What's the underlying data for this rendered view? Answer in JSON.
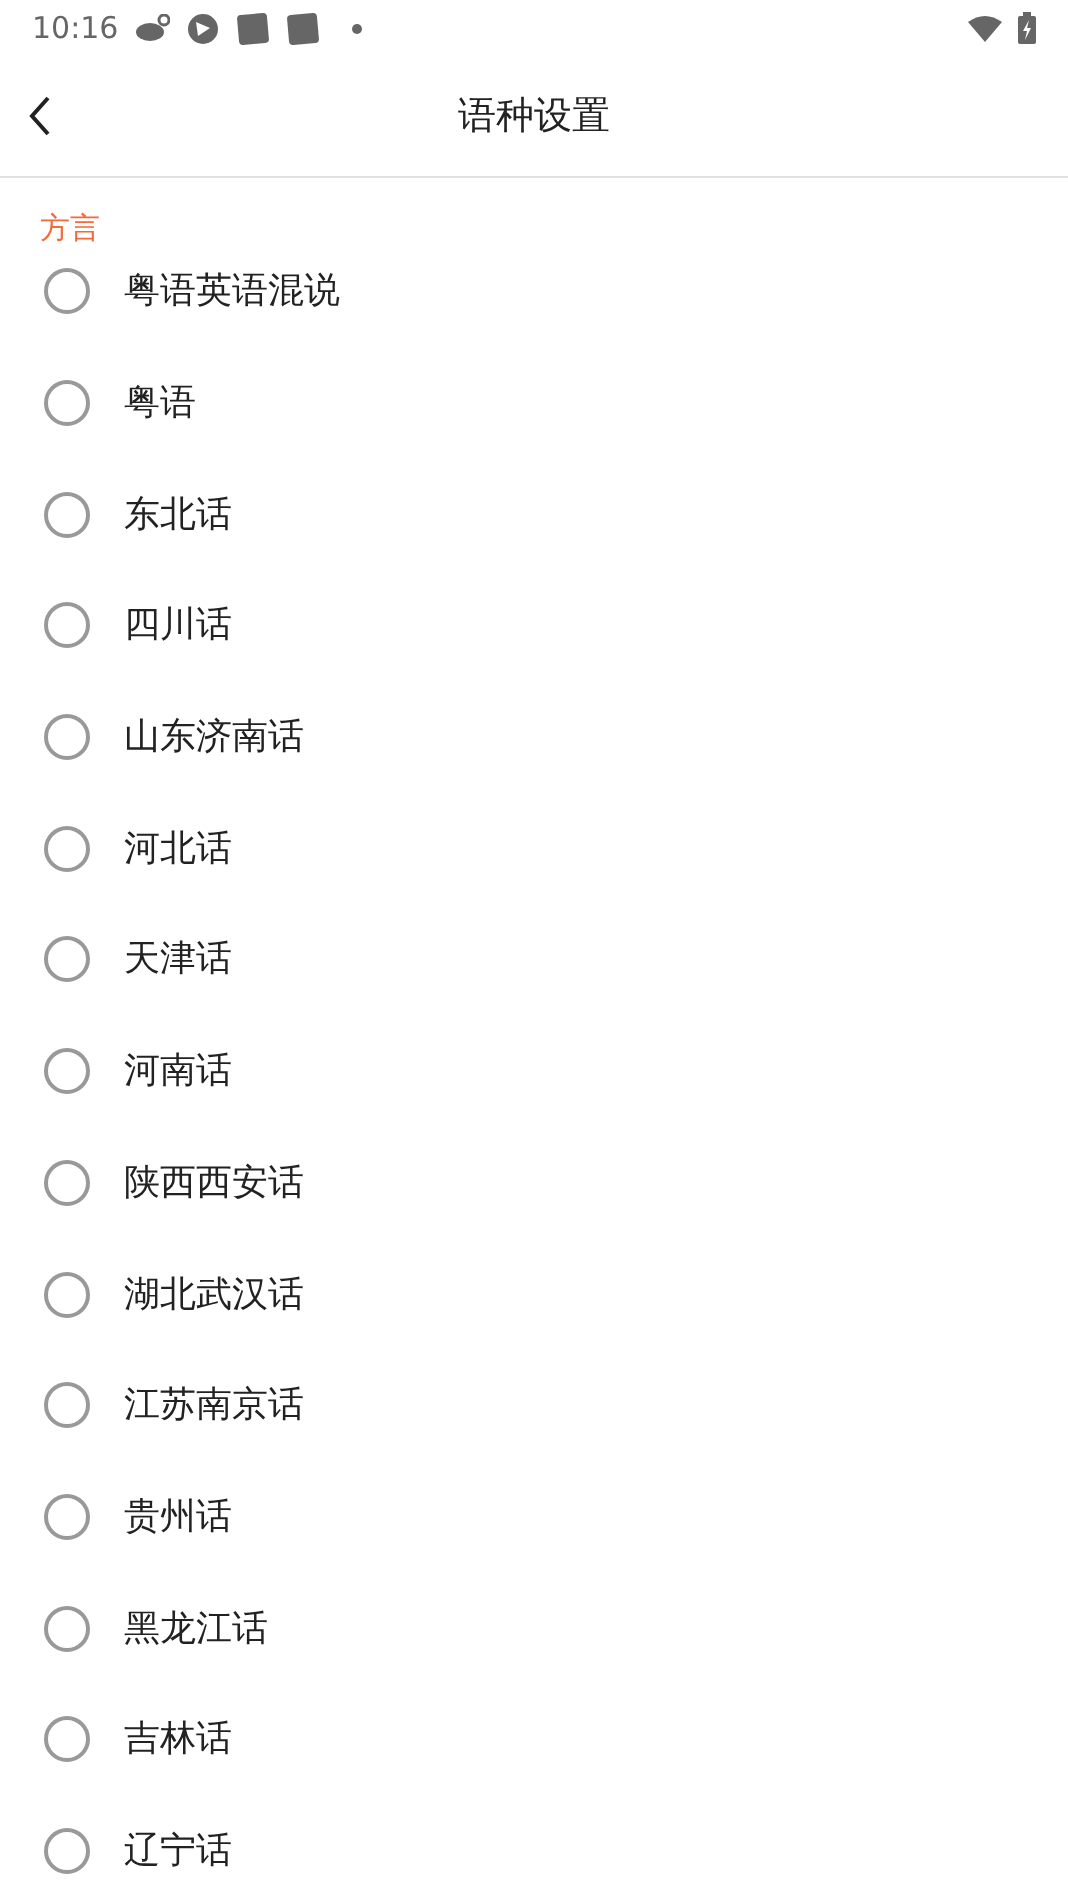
{
  "status_bar": {
    "time": "10:16"
  },
  "header": {
    "title": "语种设置"
  },
  "section": {
    "title": "方言",
    "options": [
      {
        "label": "粤语英语混说",
        "selected": false
      },
      {
        "label": "粤语",
        "selected": false
      },
      {
        "label": "东北话",
        "selected": false
      },
      {
        "label": "四川话",
        "selected": false
      },
      {
        "label": "山东济南话",
        "selected": false
      },
      {
        "label": "河北话",
        "selected": false
      },
      {
        "label": "天津话",
        "selected": false
      },
      {
        "label": "河南话",
        "selected": false
      },
      {
        "label": "陕西西安话",
        "selected": false
      },
      {
        "label": "湖北武汉话",
        "selected": false
      },
      {
        "label": "江苏南京话",
        "selected": false
      },
      {
        "label": "贵州话",
        "selected": false
      },
      {
        "label": "黑龙江话",
        "selected": false
      },
      {
        "label": "吉林话",
        "selected": false
      },
      {
        "label": "辽宁话",
        "selected": false
      }
    ]
  }
}
